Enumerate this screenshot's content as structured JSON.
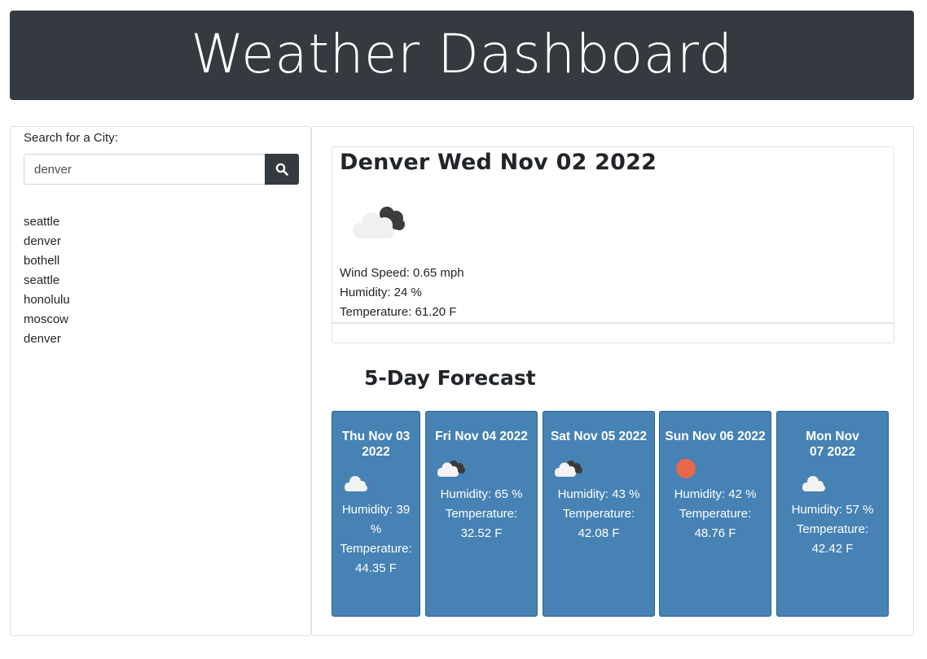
{
  "header": {
    "title": "Weather Dashboard"
  },
  "search": {
    "label": "Search for a City:",
    "value": "denver"
  },
  "history": [
    "seattle",
    "denver",
    "bothell",
    "seattle",
    "honolulu",
    "moscow",
    "denver"
  ],
  "current": {
    "title": "Denver Wed Nov 02 2022",
    "icon": "broken-clouds-icon",
    "wind": "Wind Speed: 0.65 mph",
    "humidity": "Humidity: 24 %",
    "temperature": "Temperature: 61.20 F"
  },
  "forecast": {
    "title": "5-Day Forecast",
    "days": [
      {
        "date": "Thu Nov 03 2022",
        "icon": "cloud-icon",
        "humidity": "Humidity: 39 %",
        "temperature": "Temperature: 44.35 F"
      },
      {
        "date": "Fri Nov 04 2022",
        "icon": "broken-clouds-icon",
        "humidity": "Humidity: 65 %",
        "temperature": "Temperature: 32.52 F"
      },
      {
        "date": "Sat Nov 05 2022",
        "icon": "broken-clouds-icon",
        "humidity": "Humidity: 43 %",
        "temperature": "Temperature: 42.08 F"
      },
      {
        "date": "Sun Nov 06 2022",
        "icon": "sun-icon",
        "humidity": "Humidity: 42 %",
        "temperature": "Temperature: 48.76 F"
      },
      {
        "date": "Mon Nov 07 2022",
        "icon": "cloud-icon",
        "humidity": "Humidity: 57 %",
        "temperature": "Temperature: 42.42 F"
      }
    ]
  },
  "colors": {
    "header_bg": "#343a40",
    "card_bg": "#4682b4",
    "sun": "#e8684a"
  }
}
